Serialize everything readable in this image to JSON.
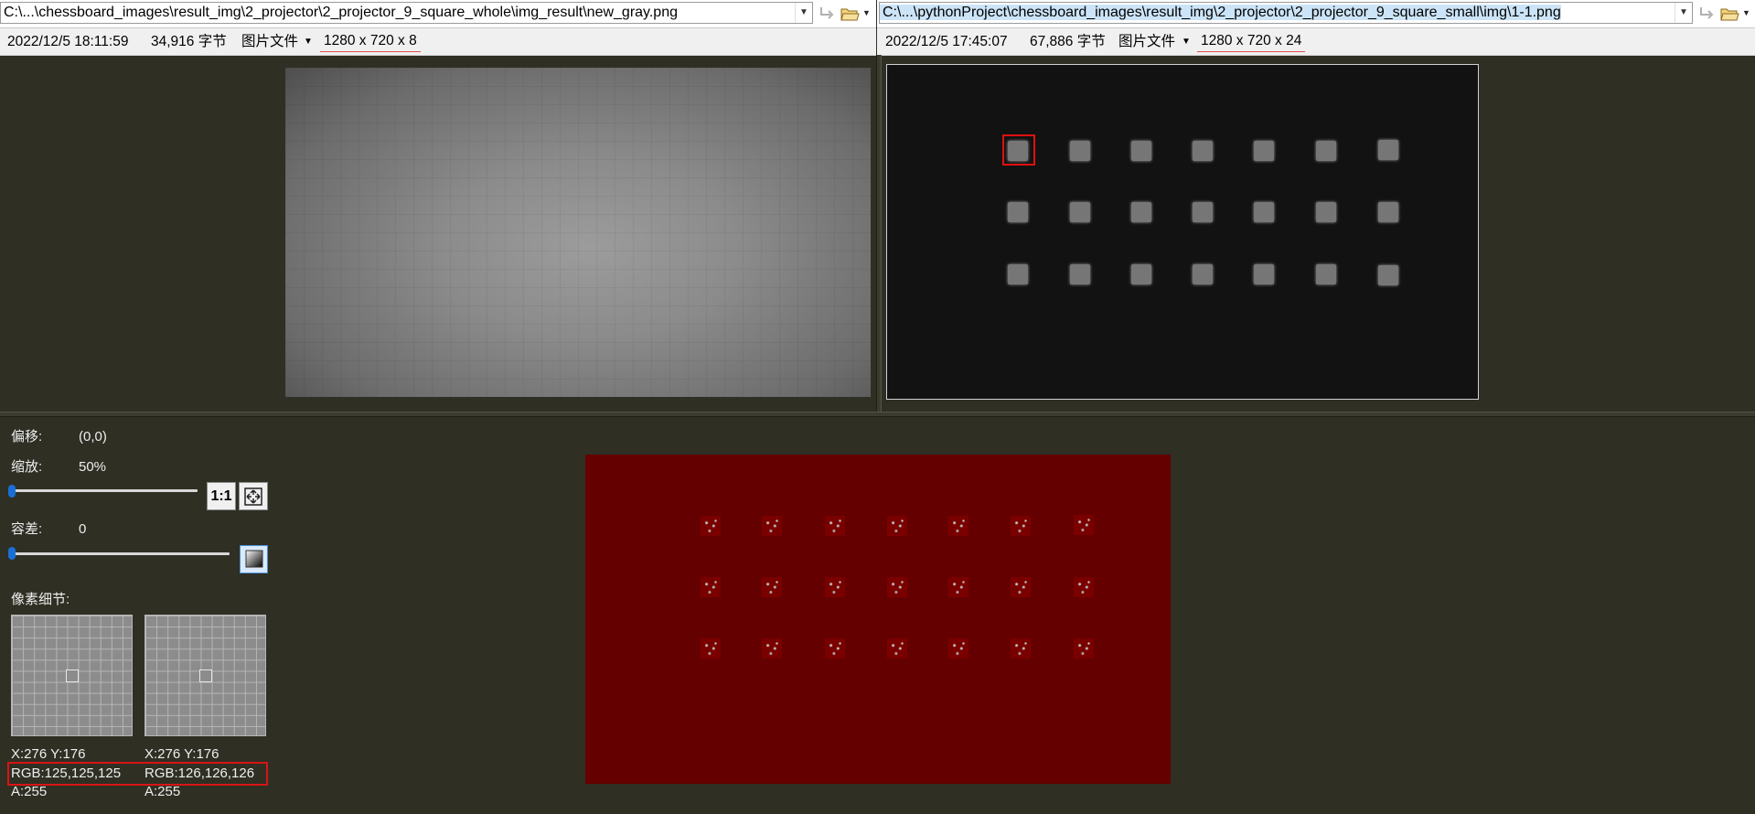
{
  "left_pane": {
    "path": "C:\\...\\chessboard_images\\result_img\\2_projector\\2_projector_9_square_whole\\img_result\\new_gray.png",
    "datetime": "2022/12/5 18:11:59",
    "size": "34,916 字节",
    "filetype": "图片文件",
    "dims": "1280 x 720 x 8"
  },
  "right_pane": {
    "path": "C:\\...\\pythonProject\\chessboard_images\\result_img\\2_projector\\2_projector_9_square_small\\img\\1-1.png",
    "datetime": "2022/12/5 17:45:07",
    "size": "67,886 字节",
    "filetype": "图片文件",
    "dims": "1280 x 720 x 24"
  },
  "controls": {
    "offset_label": "偏移:",
    "offset_value": "(0,0)",
    "zoom_label": "缩放:",
    "zoom_value": "50%",
    "zoom_slider": 0.0,
    "actual_size_label": "1:1",
    "tolerance_label": "容差:",
    "tolerance_value": "0",
    "tolerance_slider": 0.0,
    "pixel_detail_label": "像素细节:"
  },
  "pixel_info": {
    "left": {
      "xy": "X:276 Y:176",
      "rgb": "RGB:125,125,125",
      "alpha": "A:255"
    },
    "right": {
      "xy": "X:276 Y:176",
      "rgb": "RGB:126,126,126",
      "alpha": "A:255"
    }
  },
  "icons": [
    "swap-icon",
    "folder-open-icon",
    "dropdown-arrow-icon",
    "fit-to-window-icon",
    "tolerance-toggle-icon"
  ],
  "colors": {
    "background": "#2f2f24",
    "diff_background": "#650000",
    "highlight_red": "#e01010",
    "slider_thumb": "#1a6fd6"
  }
}
